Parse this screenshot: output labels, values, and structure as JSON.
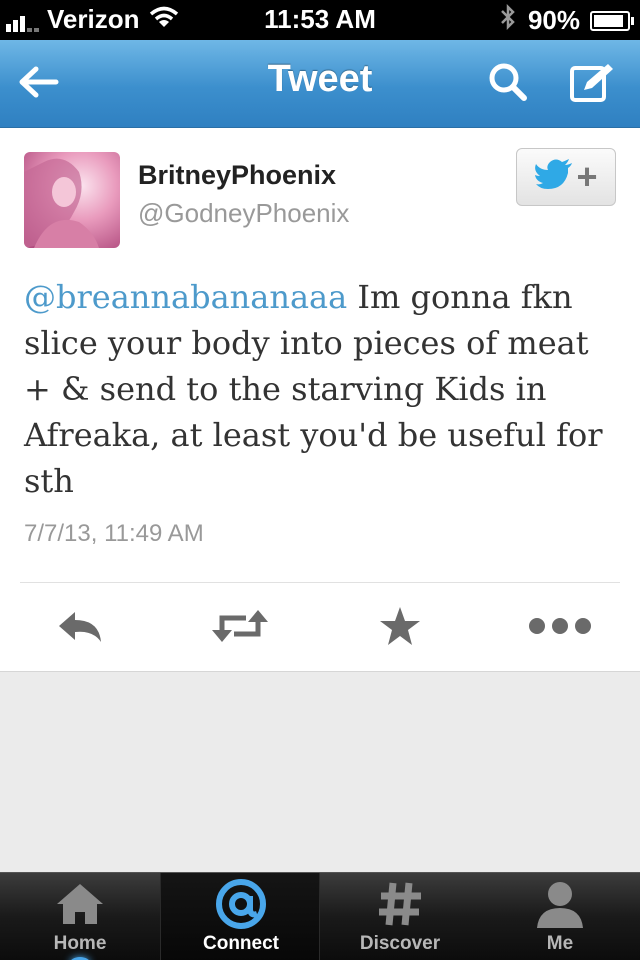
{
  "status_bar": {
    "carrier": "Verizon",
    "time": "11:53 AM",
    "battery_text": "90%",
    "battery_level": 0.9
  },
  "nav": {
    "title": "Tweet",
    "icons": [
      "back-arrow-icon",
      "search-icon",
      "compose-icon"
    ]
  },
  "tweet": {
    "display_name": "BritneyPhoenix",
    "handle": "@GodneyPhoenix",
    "mention": "@breannabananaaa",
    "body": " Im gonna fkn slice your body into pieces of meat + & send to the starving Kids in Afreaka, at least you'd be useful for sth",
    "timestamp": "7/7/13, 11:49 AM",
    "follow_button_icon": "twitter-bird-plus-icon",
    "actions": [
      "reply-icon",
      "retweet-icon",
      "favorite-star-icon",
      "more-dots-icon"
    ]
  },
  "tab_bar": {
    "tabs": [
      {
        "label": "Home",
        "icon": "home-icon"
      },
      {
        "label": "Connect",
        "icon": "at-icon",
        "active": true
      },
      {
        "label": "Discover",
        "icon": "hashtag-icon"
      },
      {
        "label": "Me",
        "icon": "person-icon"
      }
    ]
  },
  "colors": {
    "nav_blue": "#3c8fcd",
    "mention_blue": "#4d9acb",
    "bird_blue": "#2fa9e6"
  }
}
